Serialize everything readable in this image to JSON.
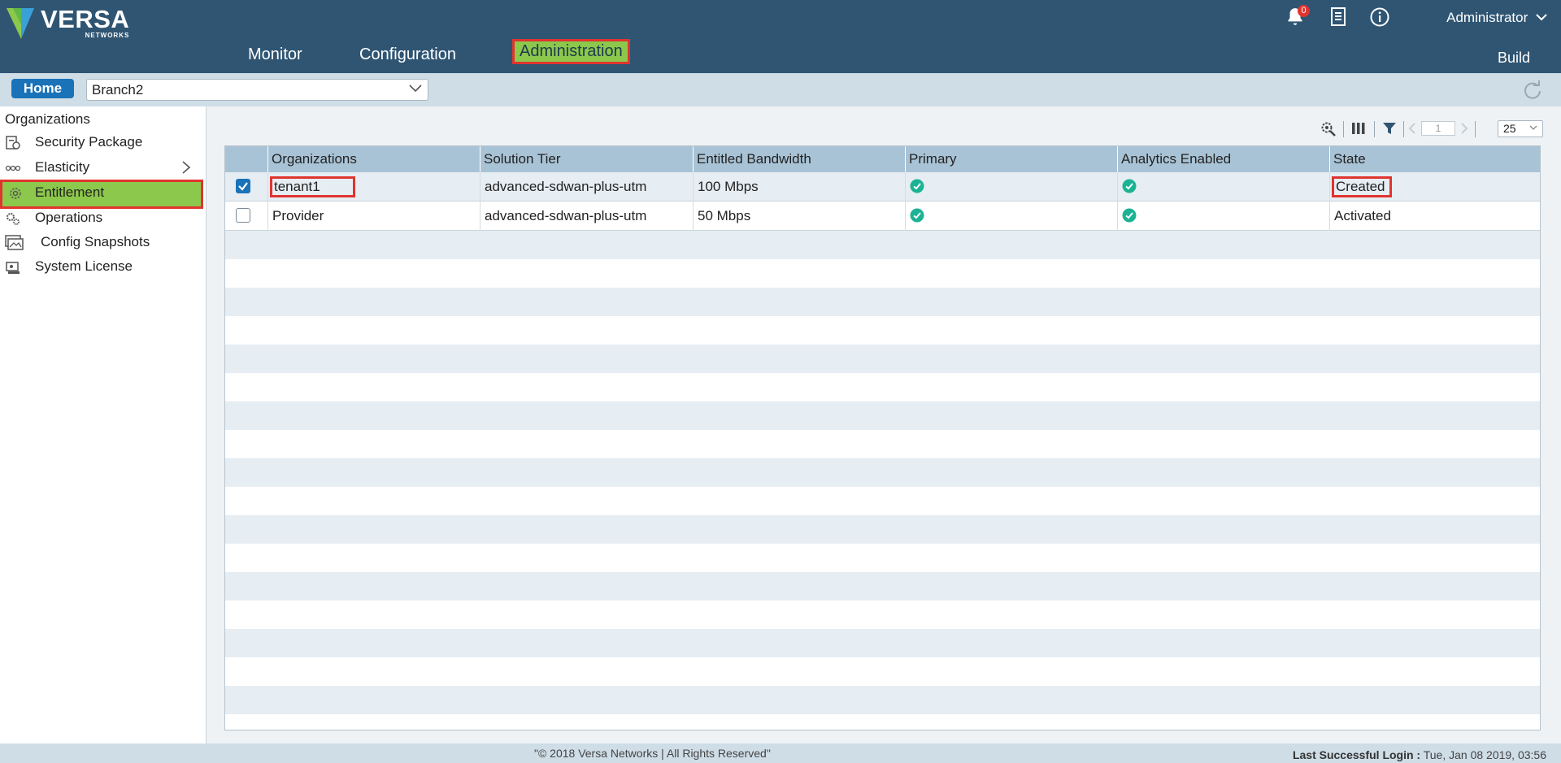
{
  "brand": {
    "name": "VERSA",
    "sub": "NETWORKS"
  },
  "nav": {
    "monitor": "Monitor",
    "configuration": "Configuration",
    "administration": "Administration"
  },
  "header": {
    "notification_count": "0",
    "user": "Administrator",
    "build": "Build"
  },
  "context": {
    "home": "Home",
    "organization": "Branch2"
  },
  "sidebar": {
    "title": "Organizations",
    "items": [
      {
        "label": "Security Package",
        "icon": "security-package-icon"
      },
      {
        "label": "Elasticity",
        "icon": "elasticity-icon"
      },
      {
        "label": "Entitlement",
        "icon": "gear-icon"
      },
      {
        "label": "Operations",
        "icon": "gears-icon"
      },
      {
        "label": "Config Snapshots",
        "icon": "snapshot-icon"
      },
      {
        "label": "System License",
        "icon": "license-icon"
      }
    ]
  },
  "toolbar": {
    "page": "1",
    "page_size": "25"
  },
  "table": {
    "columns": [
      "Organizations",
      "Solution Tier",
      "Entitled Bandwidth",
      "Primary",
      "Analytics Enabled",
      "State"
    ],
    "rows": [
      {
        "organization": "tenant1",
        "tier": "advanced-sdwan-plus-utm",
        "bandwidth": "100 Mbps",
        "primary": true,
        "analytics": true,
        "state": "Created",
        "selected": true
      },
      {
        "organization": "Provider",
        "tier": "advanced-sdwan-plus-utm",
        "bandwidth": "50 Mbps",
        "primary": true,
        "analytics": true,
        "state": "Activated",
        "selected": false
      }
    ]
  },
  "footer": {
    "copyright": "\"© 2018 Versa Networks | All Rights Reserved\"",
    "last_login_label": "Last Successful Login :",
    "last_login_value": "Tue, Jan 08 2019, 03:56"
  },
  "colors": {
    "header": "#2f5573",
    "highlight": "#8cc84b",
    "accent": "#1a73b8",
    "ok": "#1bb394",
    "callout": "#e0342f"
  }
}
